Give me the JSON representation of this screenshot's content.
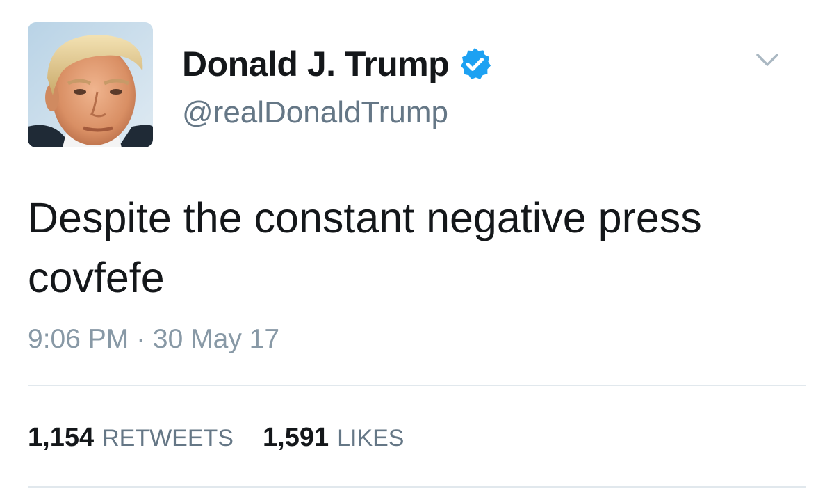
{
  "author": {
    "display_name": "Donald J. Trump",
    "handle": "@realDonaldTrump",
    "verified": true,
    "verified_icon": "verified-badge-icon",
    "verified_color": "#1da1f2"
  },
  "tweet": {
    "text": "Despite the constant negative press covfefe",
    "time": "9:06 PM",
    "separator": " · ",
    "date": "30 May 17"
  },
  "stats": {
    "retweets_count": "1,154",
    "retweets_label": "RETWEETS",
    "likes_count": "1,591",
    "likes_label": "LIKES"
  },
  "menu": {
    "icon": "chevron-down-icon"
  },
  "colors": {
    "text": "#14171a",
    "secondary": "#657786",
    "timestamp": "#8899a6",
    "divider": "#e1e8ed"
  }
}
